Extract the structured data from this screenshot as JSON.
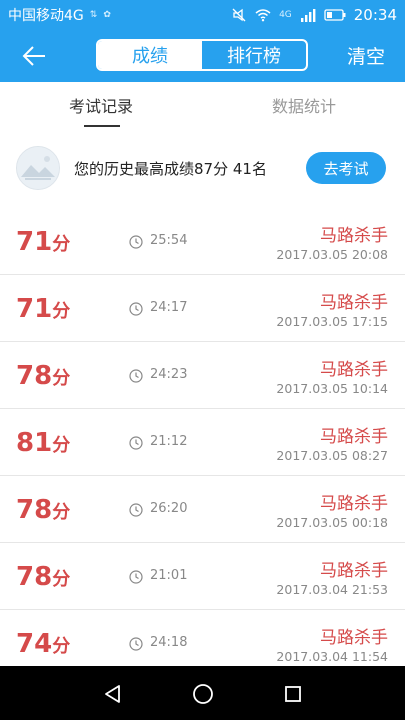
{
  "status_bar": {
    "carrier": "中国移动4G",
    "mini_label": "4G",
    "time": "20:34"
  },
  "header": {
    "segments": [
      {
        "label": "成绩",
        "active": true
      },
      {
        "label": "排行榜",
        "active": false
      }
    ],
    "clear_label": "清空"
  },
  "subtabs": [
    {
      "label": "考试记录",
      "active": true
    },
    {
      "label": "数据统计",
      "active": false
    }
  ],
  "best": {
    "text": "您的历史最高成绩87分  41名",
    "button_label": "去考试"
  },
  "records": [
    {
      "score": "71",
      "unit": "分",
      "duration": "25:54",
      "name": "马路杀手",
      "date": "2017.03.05  20:08"
    },
    {
      "score": "71",
      "unit": "分",
      "duration": "24:17",
      "name": "马路杀手",
      "date": "2017.03.05  17:15"
    },
    {
      "score": "78",
      "unit": "分",
      "duration": "24:23",
      "name": "马路杀手",
      "date": "2017.03.05  10:14"
    },
    {
      "score": "81",
      "unit": "分",
      "duration": "21:12",
      "name": "马路杀手",
      "date": "2017.03.05  08:27"
    },
    {
      "score": "78",
      "unit": "分",
      "duration": "26:20",
      "name": "马路杀手",
      "date": "2017.03.05  00:18"
    },
    {
      "score": "78",
      "unit": "分",
      "duration": "21:01",
      "name": "马路杀手",
      "date": "2017.03.04  21:53"
    },
    {
      "score": "74",
      "unit": "分",
      "duration": "24:18",
      "name": "马路杀手",
      "date": "2017.03.04  11:54"
    }
  ],
  "colors": {
    "accent": "#27a1ee",
    "score_red": "#d54a4a"
  },
  "icons": {
    "back": "arrow-left-icon",
    "clock": "clock-icon",
    "nav": [
      "back-triangle-icon",
      "home-circle-icon",
      "recents-square-icon"
    ]
  }
}
